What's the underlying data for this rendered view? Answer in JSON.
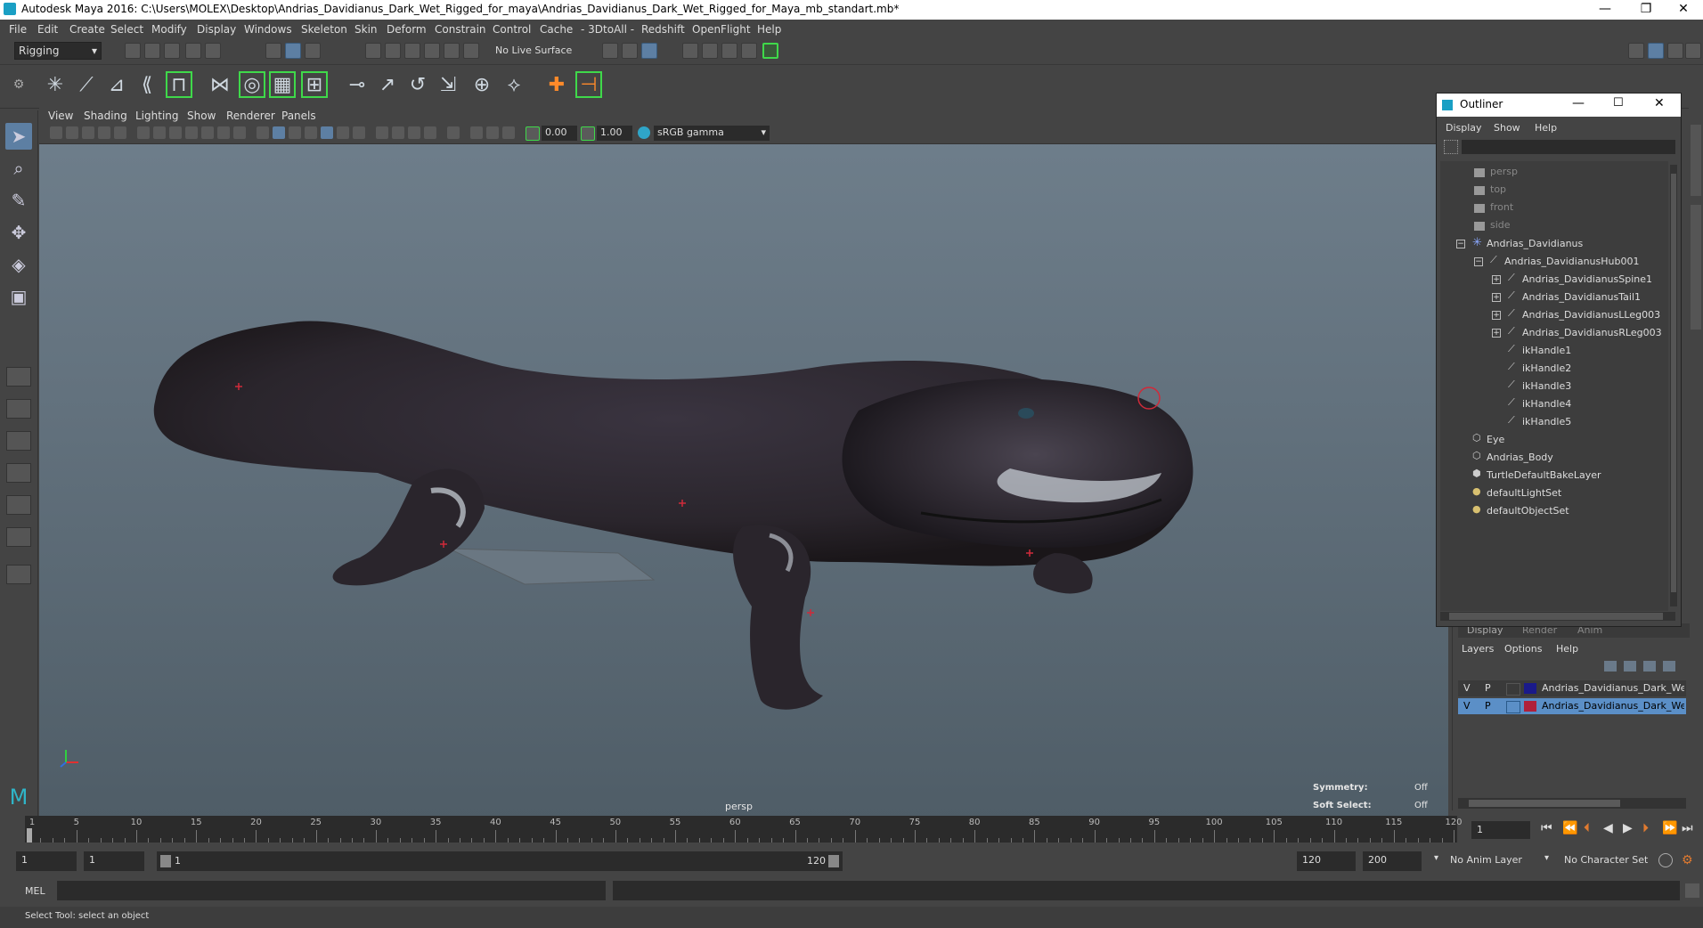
{
  "window": {
    "title": "Autodesk Maya 2016: C:\\Users\\MOLEX\\Desktop\\Andrias_Davidianus_Dark_Wet_Rigged_for_maya\\Andrias_Davidianus_Dark_Wet_Rigged_for_Maya_mb_standart.mb*",
    "minimize": "—",
    "restore": "❐",
    "close": "✕"
  },
  "menubar": [
    "File",
    "Edit",
    "Create",
    "Select",
    "Modify",
    "Display",
    "Windows",
    "Skeleton",
    "Skin",
    "Deform",
    "Constrain",
    "Control",
    "Cache",
    "- 3DtoAll -",
    "Redshift",
    "OpenFlight",
    "Help"
  ],
  "statusline": {
    "menuset": "Rigging",
    "live_surface": "No Live Surface"
  },
  "viewport": {
    "menu": [
      "View",
      "Shading",
      "Lighting",
      "Show",
      "Renderer",
      "Panels"
    ],
    "exposure": "0.00",
    "gamma": "1.00",
    "color_space": "sRGB gamma",
    "camera_label": "persp",
    "symmetry_label": "Symmetry:",
    "symmetry_value": "Off",
    "soft_select_label": "Soft Select:",
    "soft_select_value": "Off"
  },
  "outliner": {
    "title": "Outliner",
    "menu": [
      "Display",
      "Show",
      "Help"
    ],
    "items": [
      {
        "label": "persp",
        "type": "camera",
        "dim": true
      },
      {
        "label": "top",
        "type": "camera",
        "dim": true
      },
      {
        "label": "front",
        "type": "camera",
        "dim": true
      },
      {
        "label": "side",
        "type": "camera",
        "dim": true
      },
      {
        "label": "Andrias_Davidianus",
        "type": "joint-root"
      },
      {
        "label": "Andrias_DavidianusHub001",
        "type": "joint"
      },
      {
        "label": "Andrias_DavidianusSpine1",
        "type": "joint"
      },
      {
        "label": "Andrias_DavidianusTail1",
        "type": "joint"
      },
      {
        "label": "Andrias_DavidianusLLeg003",
        "type": "joint"
      },
      {
        "label": "Andrias_DavidianusRLeg003",
        "type": "joint"
      },
      {
        "label": "ikHandle1",
        "type": "ik"
      },
      {
        "label": "ikHandle2",
        "type": "ik"
      },
      {
        "label": "ikHandle3",
        "type": "ik"
      },
      {
        "label": "ikHandle4",
        "type": "ik"
      },
      {
        "label": "ikHandle5",
        "type": "ik"
      },
      {
        "label": "Eye",
        "type": "mesh"
      },
      {
        "label": "Andrias_Body",
        "type": "mesh"
      },
      {
        "label": "TurtleDefaultBakeLayer",
        "type": "bake"
      },
      {
        "label": "defaultLightSet",
        "type": "set"
      },
      {
        "label": "defaultObjectSet",
        "type": "set"
      }
    ]
  },
  "layer_editor": {
    "tabs": [
      "Display",
      "Render",
      "Anim"
    ],
    "menu": [
      "Layers",
      "Options",
      "Help"
    ],
    "layers": [
      {
        "v": "V",
        "p": "P",
        "name": "Andrias_Davidianus_Dark_Wet_R",
        "color": "#1a1a8a",
        "selected": false
      },
      {
        "v": "V",
        "p": "P",
        "name": "Andrias_Davidianus_Dark_Wet_B",
        "color": "#b0203a",
        "selected": true
      }
    ]
  },
  "timeline": {
    "ticks": [
      "1",
      "5",
      "10",
      "15",
      "20",
      "25",
      "30",
      "35",
      "40",
      "45",
      "50",
      "55",
      "60",
      "65",
      "70",
      "75",
      "80",
      "85",
      "90",
      "95",
      "100",
      "105",
      "110",
      "115",
      "120"
    ],
    "current_frame": "1"
  },
  "range": {
    "start": "1",
    "playback_start": "1",
    "slider_start": "1",
    "slider_end": "120",
    "playback_end": "120",
    "end": "200",
    "anim_layer": "No Anim Layer",
    "character_set": "No Character Set"
  },
  "cmdline": {
    "label": "MEL"
  },
  "helpline": {
    "text": "Select Tool: select an object"
  },
  "colors": {
    "accent": "#5d7fa3",
    "highlight_green": "#3fd94a",
    "selected_row": "#5b8fc7"
  }
}
